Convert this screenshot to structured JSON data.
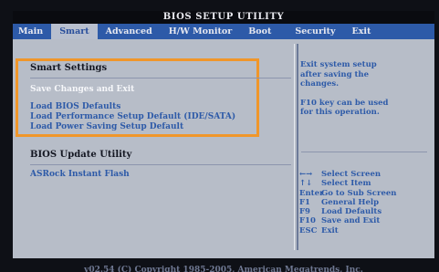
{
  "title": "BIOS SETUP UTILITY",
  "menu": [
    "Main",
    "Smart",
    "Advanced",
    "H/W Monitor",
    "Boot",
    "Security",
    "Exit"
  ],
  "active_menu": "Smart",
  "left": {
    "smart_heading": "Smart Settings",
    "options": [
      "Save Changes and Exit",
      "Load BIOS Defaults",
      "Load Performance Setup Default (IDE/SATA)",
      "Load Power Saving Setup Default"
    ],
    "update_heading": "BIOS Update Utility",
    "update_option": "ASRock Instant Flash"
  },
  "help": {
    "lines_1": [
      "Exit system setup",
      "after saving the",
      "changes."
    ],
    "lines_2": [
      "F10 key can be used",
      "for this operation."
    ]
  },
  "keys": [
    {
      "key": "←→",
      "desc": "Select Screen"
    },
    {
      "key": "↑↓",
      "desc": "Select Item"
    },
    {
      "key": "Enter",
      "desc": "Go to Sub Screen"
    },
    {
      "key": "F1",
      "desc": "General Help"
    },
    {
      "key": "F9",
      "desc": "Load Defaults"
    },
    {
      "key": "F10",
      "desc": "Save and Exit"
    },
    {
      "key": "ESC",
      "desc": "Exit"
    }
  ],
  "footer": "v02.54 (C) Copyright 1985-2005, American Megatrends, Inc.",
  "colors": {
    "menu_bar": "#2d5aa8",
    "panel": "#b7bdc8",
    "highlight_box": "#f0962a",
    "option_text": "#2d5aa8"
  }
}
